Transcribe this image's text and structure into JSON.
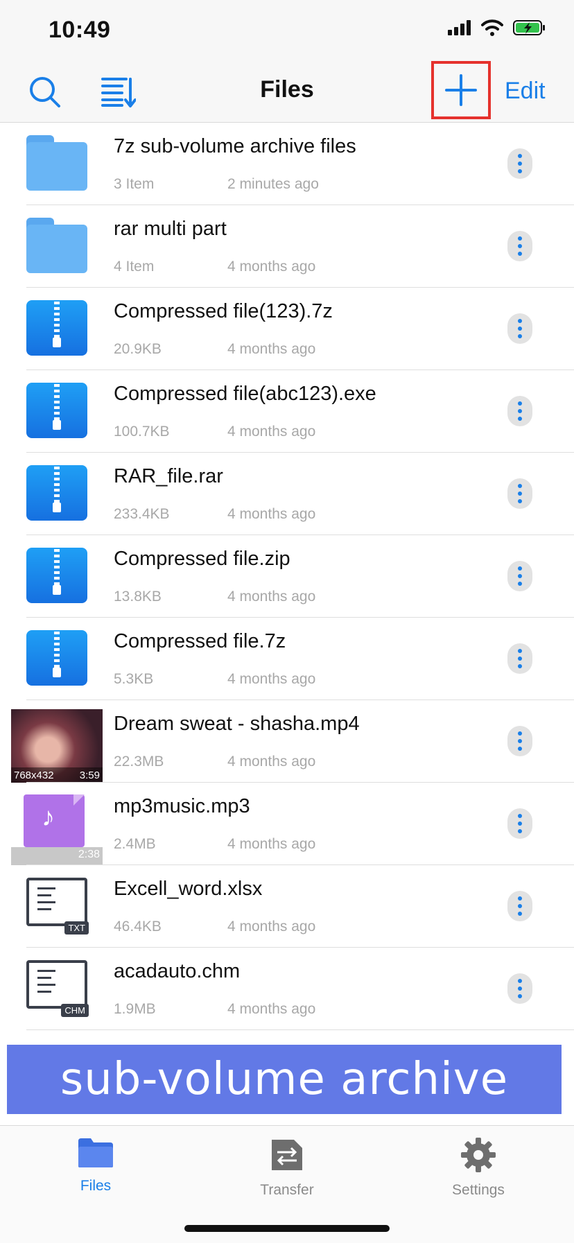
{
  "status_bar": {
    "time": "10:49"
  },
  "nav": {
    "title": "Files",
    "edit_label": "Edit"
  },
  "files": [
    {
      "kind": "folder",
      "name": "7z sub-volume archive files",
      "size": "3 Item",
      "date": "2 minutes ago"
    },
    {
      "kind": "folder",
      "name": "rar multi part",
      "size": "4 Item",
      "date": "4 months ago"
    },
    {
      "kind": "archive",
      "name": "Compressed file(123).7z",
      "size": "20.9KB",
      "date": "4 months ago"
    },
    {
      "kind": "archive",
      "name": "Compressed file(abc123).exe",
      "size": "100.7KB",
      "date": "4 months ago"
    },
    {
      "kind": "archive",
      "name": "RAR_file.rar",
      "size": "233.4KB",
      "date": "4 months ago"
    },
    {
      "kind": "archive",
      "name": "Compressed file.zip",
      "size": "13.8KB",
      "date": "4 months ago"
    },
    {
      "kind": "archive",
      "name": "Compressed file.7z",
      "size": "5.3KB",
      "date": "4 months ago"
    },
    {
      "kind": "video",
      "name": "Dream sweat - shasha.mp4",
      "size": "22.3MB",
      "date": "4 months ago",
      "resolution": "768x432",
      "duration": "3:59"
    },
    {
      "kind": "audio",
      "name": "mp3music.mp3",
      "size": "2.4MB",
      "date": "4 months ago",
      "duration": "2:38"
    },
    {
      "kind": "document",
      "name": "Excell_word.xlsx",
      "size": "46.4KB",
      "date": "4 months ago",
      "tag": "TXT"
    },
    {
      "kind": "document",
      "name": "acadauto.chm",
      "size": "1.9MB",
      "date": "4 months ago",
      "tag": "CHM"
    }
  ],
  "banner": {
    "text": "sub-volume archive"
  },
  "tabs": [
    {
      "label": "Files",
      "active": true
    },
    {
      "label": "Transfer",
      "active": false
    },
    {
      "label": "Settings",
      "active": false
    }
  ],
  "colors": {
    "accent": "#1a7fe8",
    "highlight_box": "#e5322d",
    "banner": "#6279e6",
    "folder": "#69b5f5",
    "archive": "#1f8ef0"
  },
  "icons": {
    "search": "search-icon",
    "sort": "sort-icon",
    "add": "plus-icon",
    "more": "more-options-icon"
  }
}
